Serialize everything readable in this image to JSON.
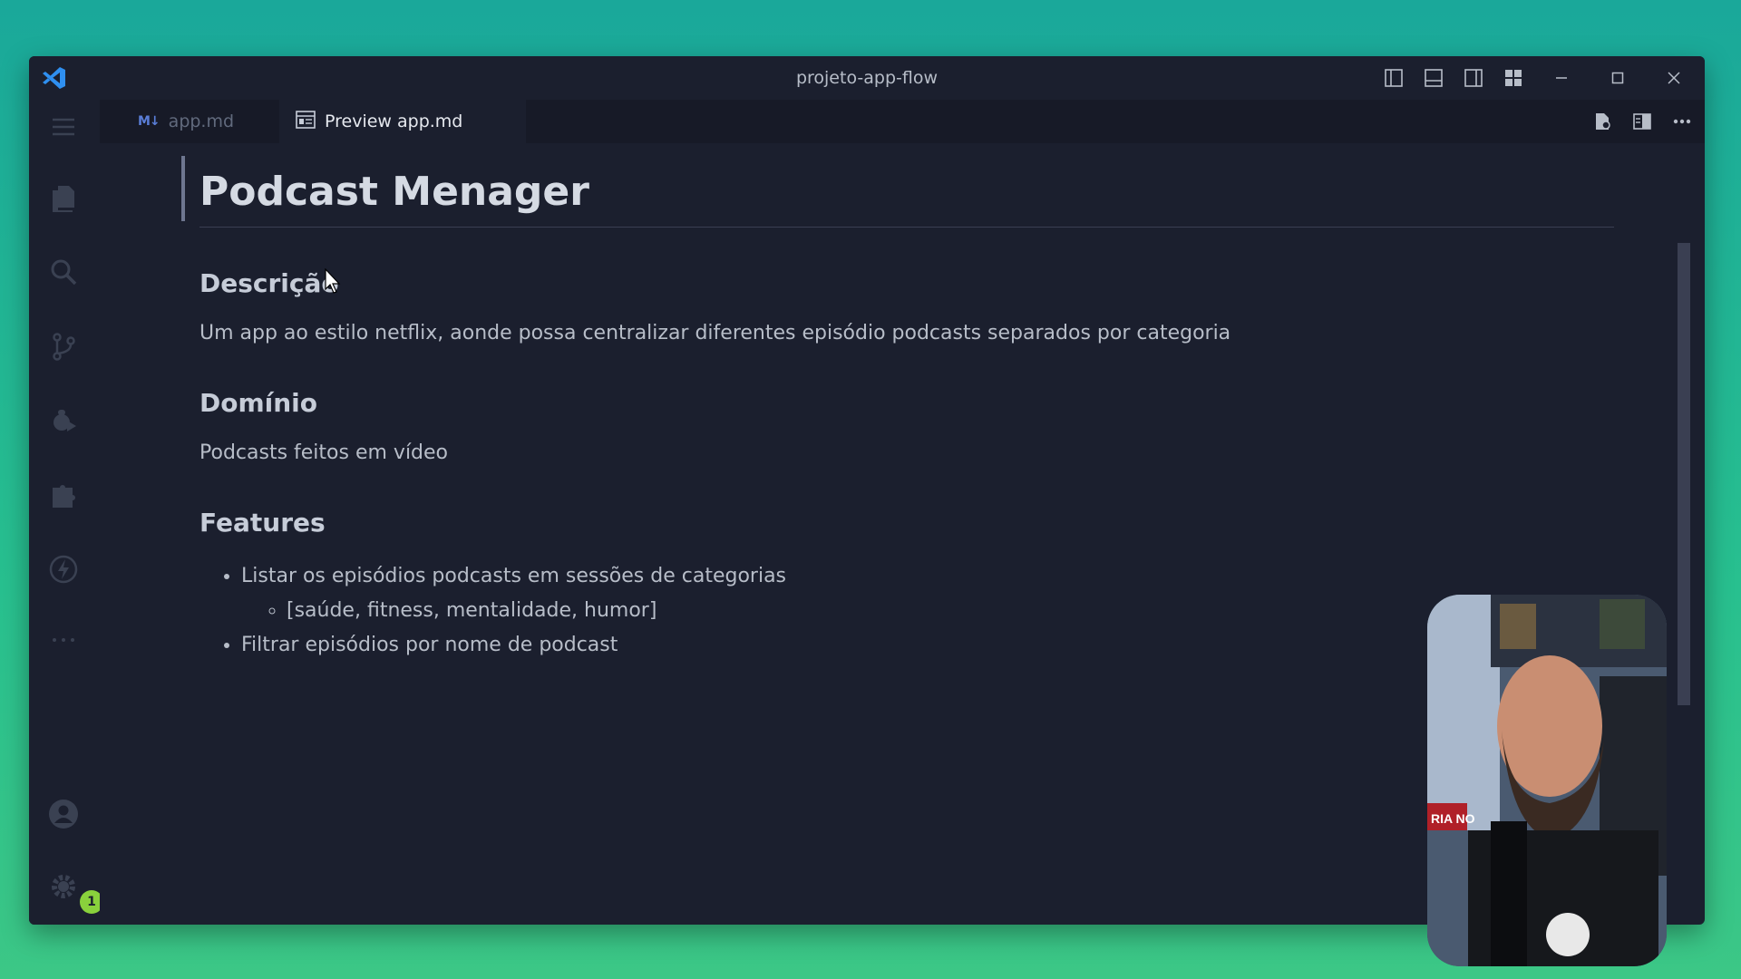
{
  "window": {
    "title": "projeto-app-flow"
  },
  "tabs": [
    {
      "label": "app.md",
      "icon": "markdown-icon",
      "active": false
    },
    {
      "label": "Preview app.md",
      "icon": "preview-icon",
      "active": true
    }
  ],
  "activity_bar": {
    "items": [
      "files-icon",
      "search-icon",
      "source-control-icon",
      "run-debug-icon",
      "extensions-icon",
      "lightning-icon",
      "more-icon"
    ],
    "bottom": [
      "account-icon",
      "settings-icon"
    ],
    "settings_badge": "1"
  },
  "document": {
    "title": "Podcast Menager",
    "sections": [
      {
        "heading": "Descrição",
        "text": "Um app ao estilo netflix, aonde possa centralizar diferentes episódio podcasts separados por categoria"
      },
      {
        "heading": "Domínio",
        "text": "Podcasts feitos em vídeo"
      },
      {
        "heading": "Features"
      }
    ],
    "features": {
      "item1": "Listar os episódios podcasts em sessões de categorias",
      "item1_sub": "[saúde, fitness, mentalidade, humor]",
      "item2": "Filtrar episódios por nome de podcast"
    }
  },
  "colors": {
    "accent_badge": "#89d13c",
    "window_bg": "#1b1f2e",
    "vscode_blue": "#2f8ff0"
  }
}
